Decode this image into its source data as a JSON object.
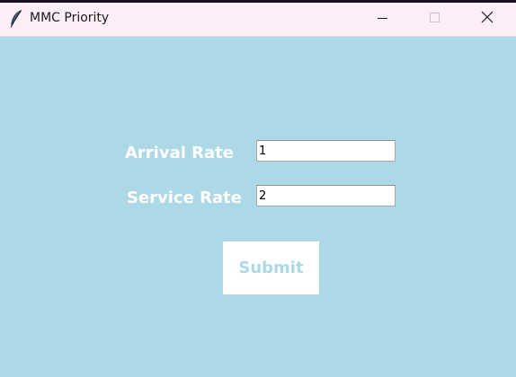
{
  "window": {
    "title": "MMC Priority",
    "icon": "feather-icon",
    "controls": {
      "minimize": "minimize-icon",
      "maximize": "maximize-icon",
      "close": "close-icon"
    }
  },
  "form": {
    "arrival_rate": {
      "label": "Arrival Rate",
      "value": "1"
    },
    "service_rate": {
      "label": "Service Rate",
      "value": "2"
    },
    "submit_label": "Submit"
  },
  "colors": {
    "background": "#add8e6",
    "label_text": "#ffffff",
    "button_background": "#ffffff",
    "button_text": "#add8e6"
  }
}
